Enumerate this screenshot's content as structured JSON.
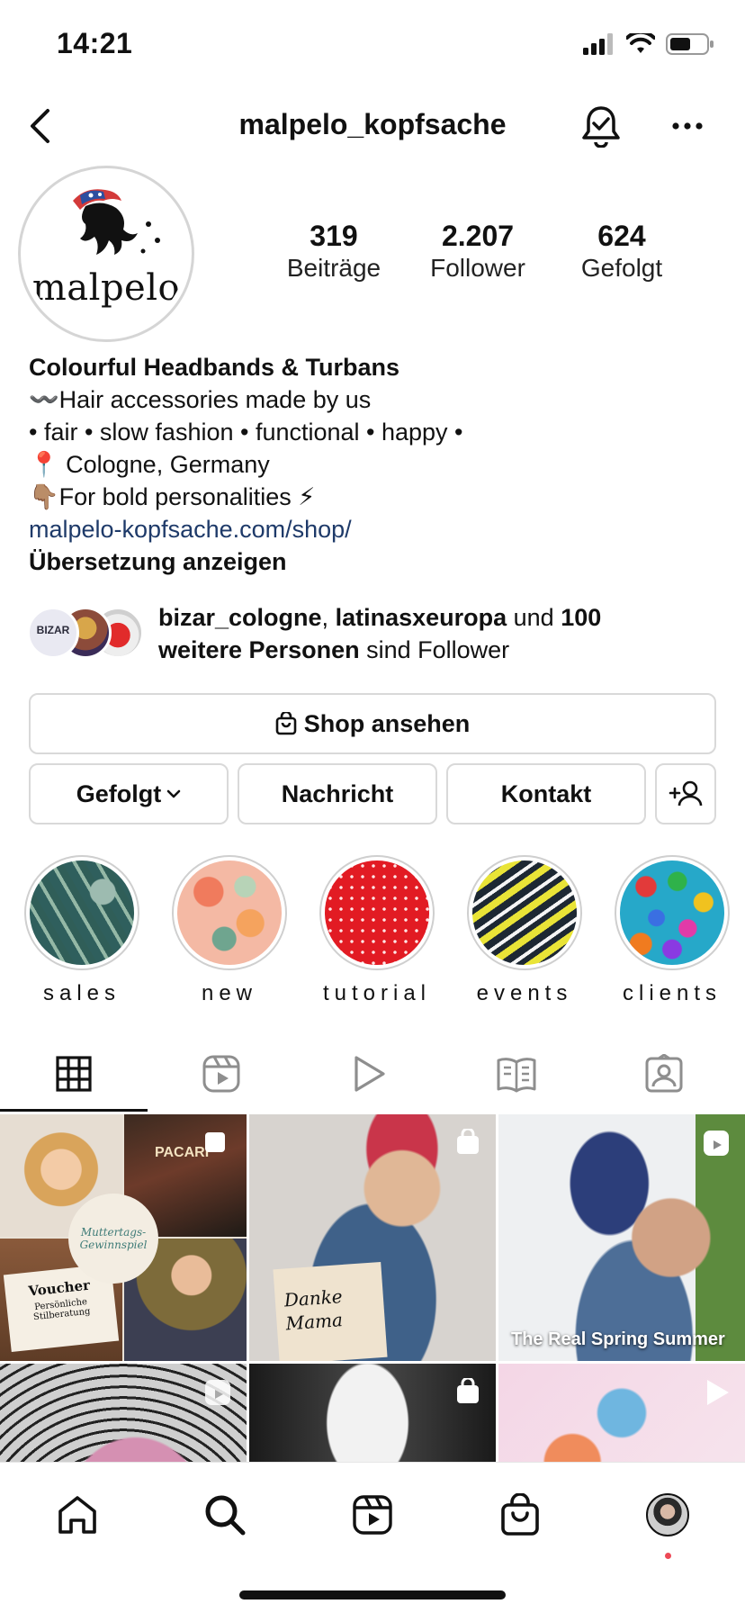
{
  "status_bar": {
    "time": "14:21"
  },
  "header": {
    "username": "malpelo_kopfsache"
  },
  "profile": {
    "logo_text": "malpelo",
    "stats": [
      {
        "value": "319",
        "label": "Beiträge"
      },
      {
        "value": "2.207",
        "label": "Follower"
      },
      {
        "value": "624",
        "label": "Gefolgt"
      }
    ],
    "bio": {
      "name": "Colourful Headbands & Turbans",
      "lines": [
        "〰️Hair accessories made by us",
        "• fair • slow fashion • functional • happy •",
        "📍 Cologne, Germany",
        "👇🏽For bold personalities ⚡"
      ],
      "link": "malpelo-kopfsache.com/shop/",
      "translate": "Übersetzung anzeigen"
    },
    "followed_by": {
      "user1": "bizar_cologne",
      "sep": ", ",
      "user2": "latinasxeuropa",
      "und": " und ",
      "count": "100",
      "weitere": "weitere Personen",
      "suffix": " sind Follower",
      "mini_avatar_text": "BIZAR"
    }
  },
  "actions": {
    "shop": "Shop ansehen",
    "following": "Gefolgt",
    "message": "Nachricht",
    "contact": "Kontakt"
  },
  "highlights": [
    {
      "label": "sales"
    },
    {
      "label": "new"
    },
    {
      "label": "tutorial"
    },
    {
      "label": "events"
    },
    {
      "label": "clients"
    }
  ],
  "tabs": [
    "grid-icon",
    "reels-icon",
    "video-icon",
    "guides-icon",
    "tagged-icon"
  ],
  "grid": {
    "posts": [
      {
        "overlay_title": "Muttertags-Gewinnspiel",
        "voucher": "Voucher",
        "voucher_sub": "Persönliche Stilberatung",
        "brand": "PACARI"
      },
      {
        "note": "Danke Mama"
      },
      {
        "caption": "The Real Spring Summer"
      },
      {},
      {},
      {}
    ]
  },
  "bottom_nav": [
    "home-icon",
    "search-icon",
    "reels-icon",
    "shop-icon",
    "profile-avatar"
  ],
  "colors": {
    "link": "#1e3a69",
    "notification_dot": "#ed4956"
  }
}
